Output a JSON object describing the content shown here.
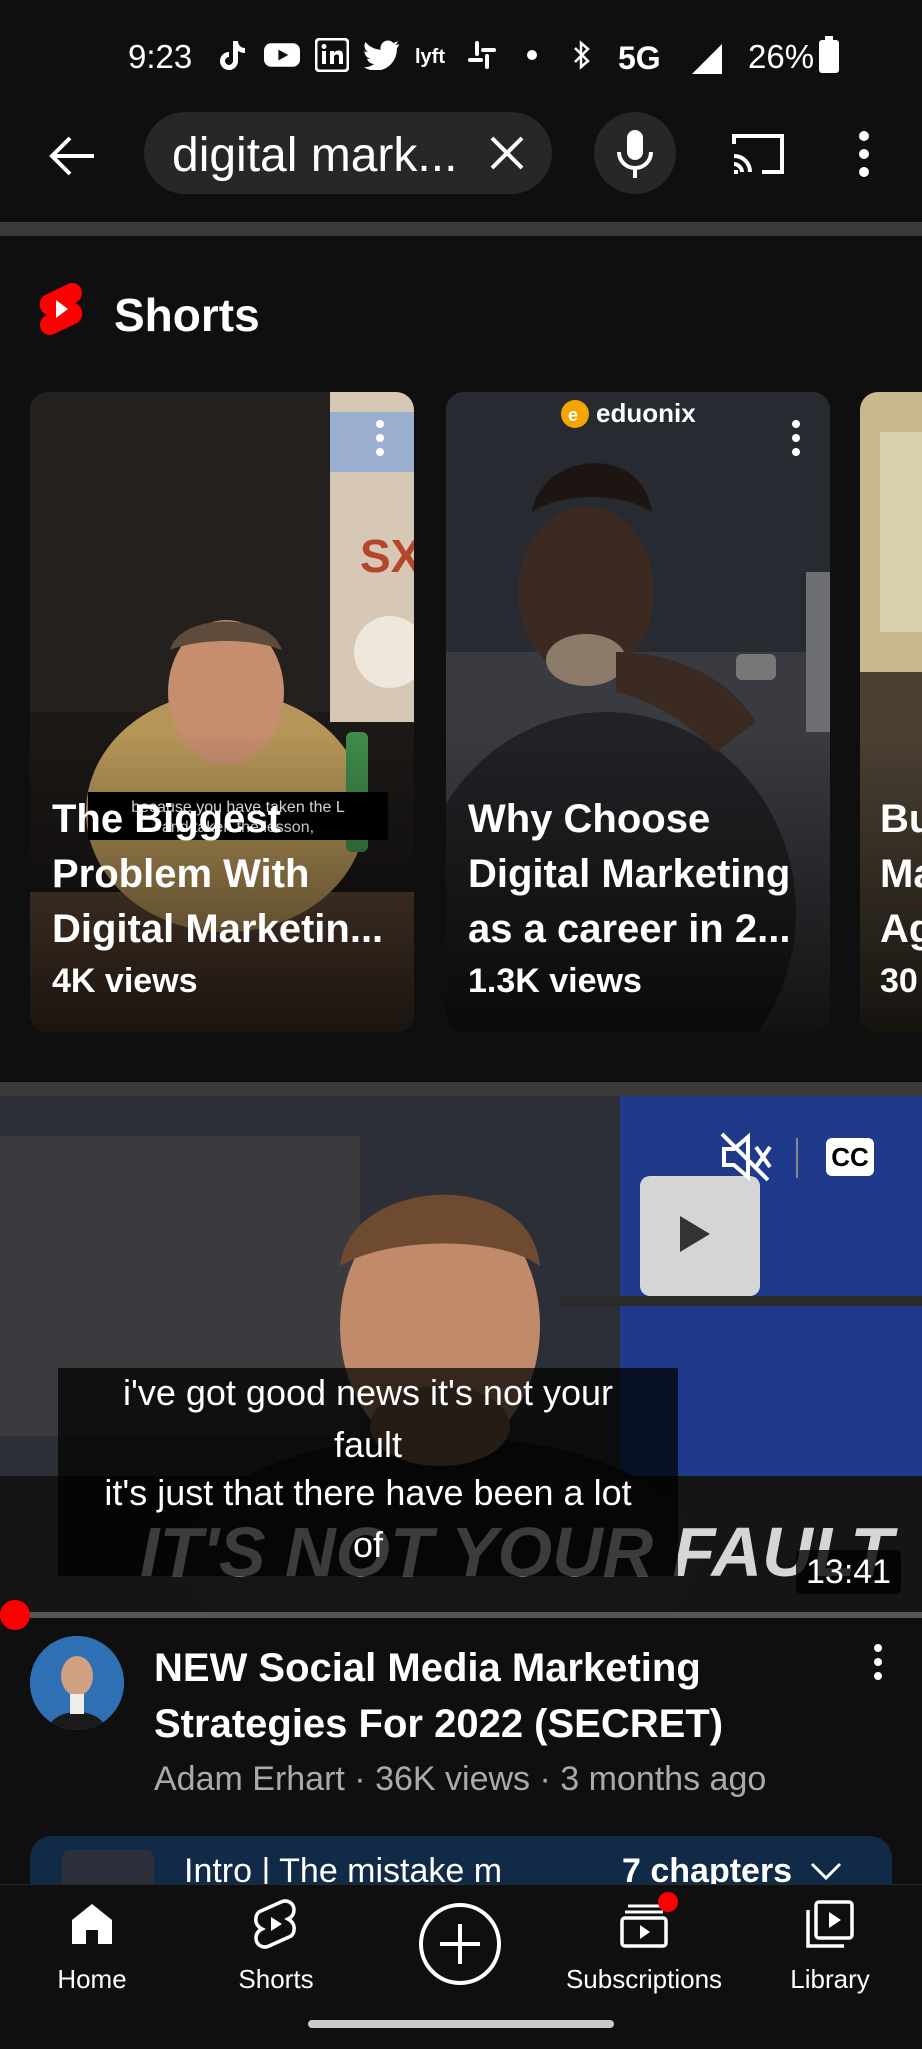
{
  "status_bar": {
    "time": "9:23",
    "network": "5G",
    "battery": "26%",
    "icons": [
      "tiktok-icon",
      "youtube-icon",
      "linkedin-icon",
      "twitter-icon",
      "lyft-icon",
      "slack-icon",
      "dot-icon",
      "bluetooth-icon"
    ]
  },
  "header": {
    "search_value": "digital mark...",
    "back_icon": "arrow-back-icon",
    "clear_icon": "close-icon",
    "mic_icon": "mic-icon",
    "cast_icon": "cast-icon",
    "more_icon": "more-vertical-icon"
  },
  "shorts": {
    "section_title": "Shorts",
    "cards": [
      {
        "title": "The Biggest Problem With Digital Marketin...",
        "views": "4K views",
        "overlay_caption": "because you have taken the L and taken the lesson,"
      },
      {
        "title": "Why Choose Digital Marketing as a career in 2...",
        "views": "1.3K views",
        "brand": "eduonix"
      },
      {
        "title": "Bu Ma Ag",
        "views": "30"
      }
    ]
  },
  "video": {
    "caption_lines": [
      "i've got good news it's not your",
      "fault",
      "it's just that there have been a lot",
      "of"
    ],
    "background_text": "IT'S NOT YOUR FAULT",
    "duration": "13:41",
    "cc_label": "CC",
    "progress": 0.0,
    "title": "NEW Social Media Marketing Strategies For 2022 (SECRET)",
    "meta": "Adam Erhart · 36K views · 3 months ago",
    "chapter_text": "Intro | The mistake m",
    "chapter_count": "7 chapters"
  },
  "bottom_nav": {
    "items": [
      {
        "label": "Home",
        "icon": "home-icon"
      },
      {
        "label": "Shorts",
        "icon": "shorts-icon"
      },
      {
        "label": "",
        "icon": "create-plus-icon"
      },
      {
        "label": "Subscriptions",
        "icon": "subscriptions-icon"
      },
      {
        "label": "Library",
        "icon": "library-icon"
      }
    ]
  },
  "colors": {
    "background": "#0f0f0f",
    "youtube_red": "#ff0000",
    "pill": "#272727",
    "meta_text": "#aaaaaa"
  }
}
